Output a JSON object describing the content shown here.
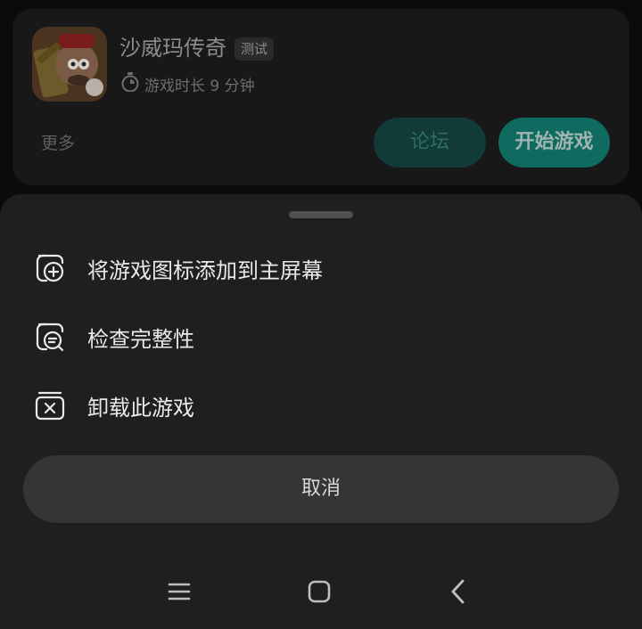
{
  "game": {
    "title": "沙威玛传奇",
    "badge": "测试",
    "playtime": "游戏时长 9 分钟",
    "more_label": "更多",
    "forum_button": "论坛",
    "start_button": "开始游戏",
    "icon": "game-cover-icon"
  },
  "sheet": {
    "menu": [
      {
        "label": "将游戏图标添加到主屏幕",
        "icon": "add-to-home-icon"
      },
      {
        "label": "检查完整性",
        "icon": "check-integrity-icon"
      },
      {
        "label": "卸载此游戏",
        "icon": "uninstall-icon"
      }
    ],
    "cancel_label": "取消"
  },
  "nav": {
    "buttons": [
      "menu-icon",
      "home-icon",
      "back-icon"
    ]
  },
  "colors": {
    "sheet_bg": "#1f1f1f",
    "cancel_bg": "#353535",
    "accent": "#0f6a5f"
  }
}
